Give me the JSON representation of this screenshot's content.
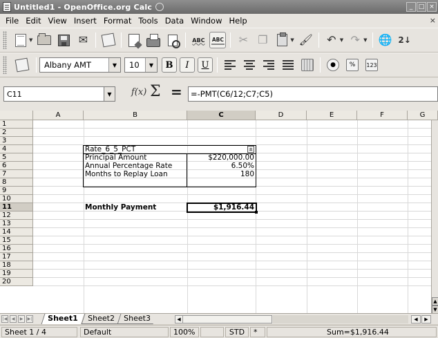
{
  "window": {
    "title": "Untitled1 - OpenOffice.org Calc",
    "buttons": [
      "_",
      "□",
      "×"
    ]
  },
  "menu": [
    "File",
    "Edit",
    "View",
    "Insert",
    "Format",
    "Tools",
    "Data",
    "Window",
    "Help"
  ],
  "menu_close": "×",
  "toolbar": {
    "font_name": "Albany AMT",
    "font_size": "10",
    "bold_label": "B",
    "italic_label": "I",
    "underline_label": "U",
    "percent_label": "%",
    "number_label": "123",
    "abc1": "ABC",
    "abc2": "ABC",
    "sort_label": "2↓"
  },
  "formula_bar": {
    "cell_ref": "C11",
    "fx": "f(x)",
    "sum": "Σ",
    "equals": "=",
    "formula": "=-PMT(C6/12;C7;C5)"
  },
  "columns": [
    "A",
    "B",
    "C",
    "D",
    "E",
    "F",
    "G"
  ],
  "selected_column": "C",
  "rows": [
    "1",
    "2",
    "3",
    "4",
    "5",
    "6",
    "7",
    "8",
    "9",
    "10",
    "11",
    "12",
    "13",
    "14",
    "15",
    "16",
    "17",
    "18",
    "19",
    "20"
  ],
  "selected_row": "11",
  "cells": {
    "B4": "Rate_6_5_PCT",
    "B5": "Principal Amount",
    "C5": "$220,000.00",
    "B6": "Annual Percentage Rate",
    "C6": "6.50%",
    "B7": "Months to Replay Loan",
    "C7": "180",
    "B11": "Monthly Payment",
    "C11": "$1,916.44"
  },
  "filter_button": "±",
  "sheets": [
    "Sheet1",
    "Sheet2",
    "Sheet3"
  ],
  "active_sheet": "Sheet1",
  "status": {
    "sheet": "Sheet 1 / 4",
    "style": "Default",
    "zoom": "100%",
    "mode": "STD",
    "modified": "*",
    "sum": "Sum=$1,916.44"
  }
}
